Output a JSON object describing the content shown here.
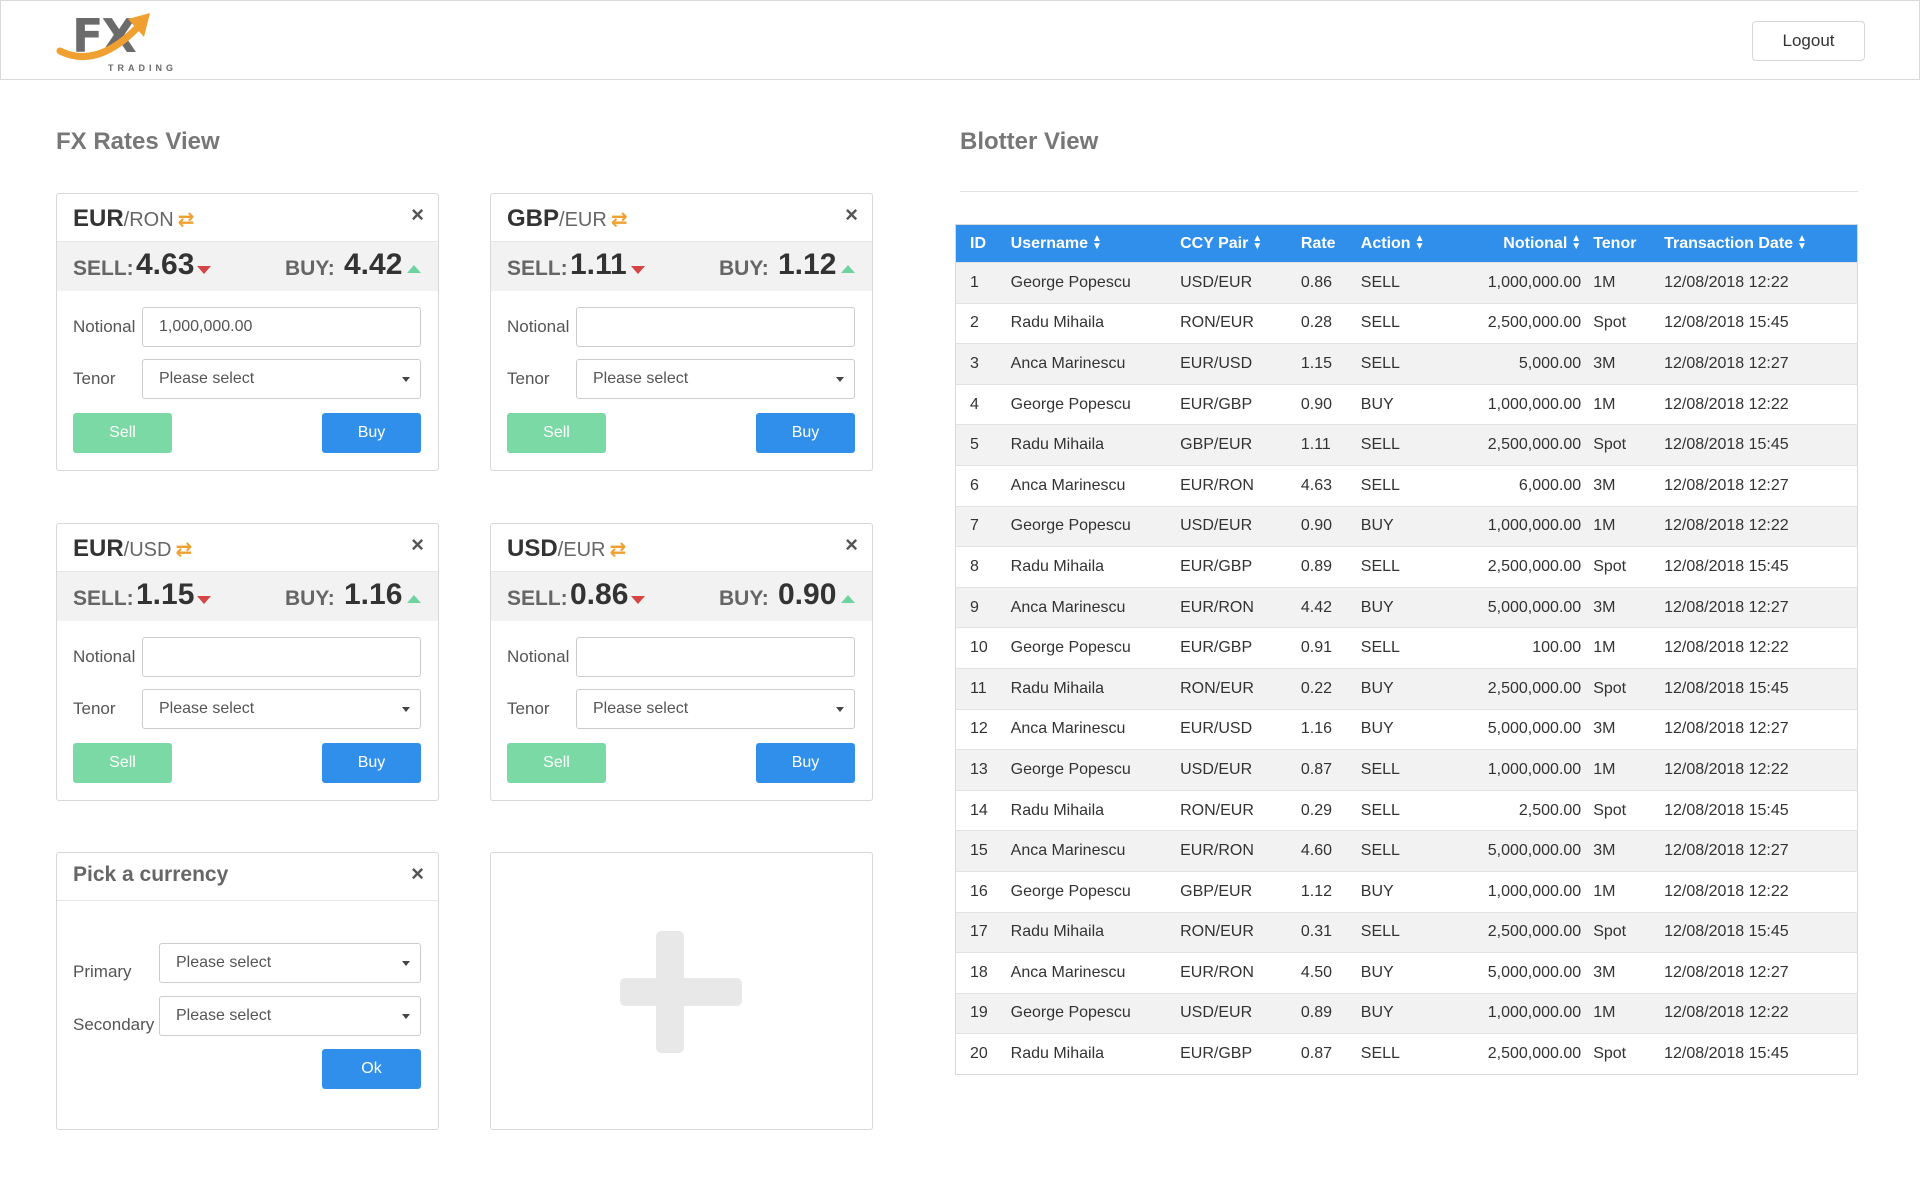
{
  "header": {
    "logo_text": "FX",
    "logo_sub": "TRADING",
    "logout_label": "Logout",
    "accent_color": "#f0a030"
  },
  "rates": {
    "title": "FX Rates View",
    "sell_label": "SELL:",
    "buy_label": "BUY:",
    "notional_label": "Notional",
    "tenor_label": "Tenor",
    "tenor_placeholder": "Please select",
    "sell_btn": "Sell",
    "buy_btn": "Buy",
    "cards": [
      {
        "primary": "EUR",
        "secondary": "/RON",
        "sell": "4.63",
        "buy": "4.42",
        "notional": "1,000,000.00"
      },
      {
        "primary": "GBP",
        "secondary": "/EUR",
        "sell": "1.11",
        "buy": "1.12",
        "notional": ""
      },
      {
        "primary": "EUR",
        "secondary": "/USD",
        "sell": "1.15",
        "buy": "1.16",
        "notional": ""
      },
      {
        "primary": "USD",
        "secondary": "/EUR",
        "sell": "0.86",
        "buy": "0.90",
        "notional": ""
      }
    ],
    "picker": {
      "title": "Pick a currency",
      "primary_label": "Primary",
      "secondary_label": "Secondary",
      "primary_value": "Please select",
      "secondary_value": "Please select",
      "ok_label": "Ok"
    },
    "add_icon": "plus-icon"
  },
  "blotter": {
    "title": "Blotter View",
    "headers": [
      "ID",
      "Username",
      "CCY Pair",
      "Rate",
      "Action",
      "Notional",
      "Tenor",
      "Transaction Date"
    ],
    "rows": [
      [
        "1",
        "George Popescu",
        "USD/EUR",
        "0.86",
        "SELL",
        "1,000,000.00",
        "1M",
        "12/08/2018 12:22"
      ],
      [
        "2",
        "Radu Mihaila",
        "RON/EUR",
        "0.28",
        "SELL",
        "2,500,000.00",
        "Spot",
        "12/08/2018 15:45"
      ],
      [
        "3",
        "Anca Marinescu",
        "EUR/USD",
        "1.15",
        "SELL",
        "5,000.00",
        "3M",
        "12/08/2018 12:27"
      ],
      [
        "4",
        "George Popescu",
        "EUR/GBP",
        "0.90",
        "BUY",
        "1,000,000.00",
        "1M",
        "12/08/2018 12:22"
      ],
      [
        "5",
        "Radu Mihaila",
        "GBP/EUR",
        "1.11",
        "SELL",
        "2,500,000.00",
        "Spot",
        "12/08/2018 15:45"
      ],
      [
        "6",
        "Anca Marinescu",
        "EUR/RON",
        "4.63",
        "SELL",
        "6,000.00",
        "3M",
        "12/08/2018 12:27"
      ],
      [
        "7",
        "George Popescu",
        "USD/EUR",
        "0.90",
        "BUY",
        "1,000,000.00",
        "1M",
        "12/08/2018 12:22"
      ],
      [
        "8",
        "Radu Mihaila",
        "EUR/GBP",
        "0.89",
        "SELL",
        "2,500,000.00",
        "Spot",
        "12/08/2018 15:45"
      ],
      [
        "9",
        "Anca Marinescu",
        "EUR/RON",
        "4.42",
        "BUY",
        "5,000,000.00",
        "3M",
        "12/08/2018 12:27"
      ],
      [
        "10",
        "George Popescu",
        "EUR/GBP",
        "0.91",
        "SELL",
        "100.00",
        "1M",
        "12/08/2018 12:22"
      ],
      [
        "11",
        "Radu Mihaila",
        "RON/EUR",
        "0.22",
        "BUY",
        "2,500,000.00",
        "Spot",
        "12/08/2018 15:45"
      ],
      [
        "12",
        "Anca Marinescu",
        "EUR/USD",
        "1.16",
        "BUY",
        "5,000,000.00",
        "3M",
        "12/08/2018 12:27"
      ],
      [
        "13",
        "George Popescu",
        "USD/EUR",
        "0.87",
        "SELL",
        "1,000,000.00",
        "1M",
        "12/08/2018 12:22"
      ],
      [
        "14",
        "Radu Mihaila",
        "RON/EUR",
        "0.29",
        "SELL",
        "2,500.00",
        "Spot",
        "12/08/2018 15:45"
      ],
      [
        "15",
        "Anca Marinescu",
        "EUR/RON",
        "4.60",
        "SELL",
        "5,000,000.00",
        "3M",
        "12/08/2018 12:27"
      ],
      [
        "16",
        "George Popescu",
        "GBP/EUR",
        "1.12",
        "BUY",
        "1,000,000.00",
        "1M",
        "12/08/2018 12:22"
      ],
      [
        "17",
        "Radu Mihaila",
        "RON/EUR",
        "0.31",
        "SELL",
        "2,500,000.00",
        "Spot",
        "12/08/2018 15:45"
      ],
      [
        "18",
        "Anca Marinescu",
        "EUR/RON",
        "4.50",
        "BUY",
        "5,000,000.00",
        "3M",
        "12/08/2018 12:27"
      ],
      [
        "19",
        "George Popescu",
        "USD/EUR",
        "0.89",
        "BUY",
        "1,000,000.00",
        "1M",
        "12/08/2018 12:22"
      ],
      [
        "20",
        "Radu Mihaila",
        "EUR/GBP",
        "0.87",
        "SELL",
        "2,500,000.00",
        "Spot",
        "12/08/2018 15:45"
      ]
    ],
    "header_color": "#2f8fea"
  }
}
